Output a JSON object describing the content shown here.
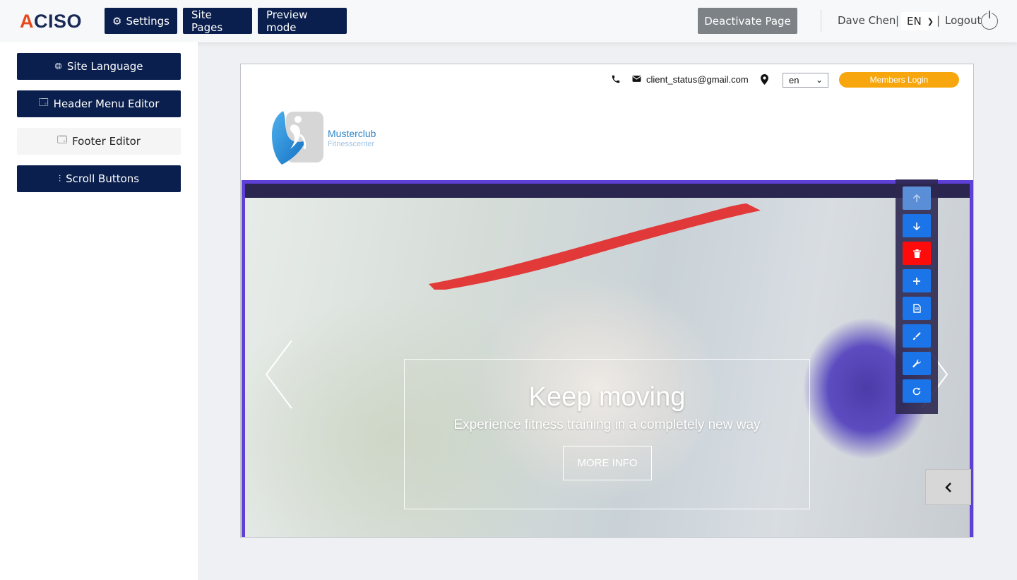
{
  "header": {
    "logo_text": "ACISO",
    "settings_label": "Settings",
    "site_pages_label": "Site Pages",
    "preview_label": "Preview mode",
    "deactivate_label": "Deactivate Page",
    "user_name": "Dave Chen",
    "separator": "|",
    "language": "EN",
    "logout_label": "Logout"
  },
  "sidebar": {
    "items": [
      {
        "label": "Site Language",
        "icon": "globe-icon"
      },
      {
        "label": "Header Menu Editor",
        "icon": "window-icon"
      },
      {
        "label": "Footer Editor",
        "icon": "window-icon"
      },
      {
        "label": "Scroll Buttons",
        "icon": "sliders-icon"
      }
    ]
  },
  "site": {
    "email": "client_status@gmail.com",
    "language": "en",
    "members_login": "Members Login",
    "brand_name": "Musterclub",
    "brand_tagline": "Fitnesscenter",
    "hero": {
      "title": "Keep moving",
      "subtitle": "Experience fitness training in a completely new way",
      "button": "MORE INFO"
    }
  },
  "toolbar": {
    "buttons": [
      {
        "name": "move-up",
        "icon": "arrow-up-icon",
        "state": "disabled"
      },
      {
        "name": "move-down",
        "icon": "arrow-down-icon"
      },
      {
        "name": "delete",
        "icon": "trash-icon",
        "color": "#ff0b0b"
      },
      {
        "name": "add",
        "icon": "plus-icon"
      },
      {
        "name": "duplicate",
        "icon": "copy-icon"
      },
      {
        "name": "style",
        "icon": "brush-icon"
      },
      {
        "name": "settings",
        "icon": "wrench-icon"
      },
      {
        "name": "refresh",
        "icon": "refresh-icon"
      }
    ]
  },
  "colors": {
    "navy": "#0a1f4d",
    "selection": "#5e3fd8",
    "members_orange": "#f7a70d",
    "tool_blue": "#1b74e8"
  }
}
